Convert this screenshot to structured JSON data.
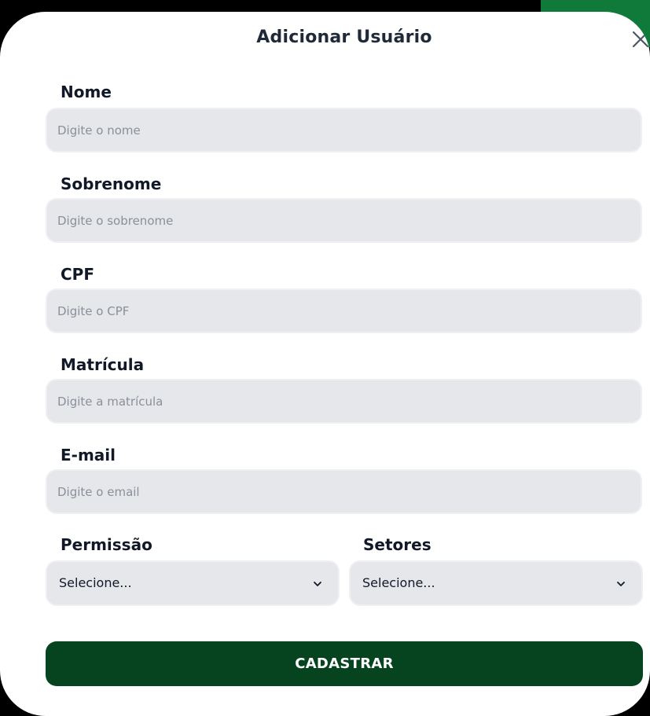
{
  "modal": {
    "title": "Adicionar Usuário",
    "close_icon": "close-icon"
  },
  "form": {
    "nome": {
      "label": "Nome",
      "placeholder": "Digite o nome",
      "value": ""
    },
    "sobrenome": {
      "label": "Sobrenome",
      "placeholder": "Digite o sobrenome",
      "value": ""
    },
    "cpf": {
      "label": "CPF",
      "placeholder": "Digite o CPF",
      "value": ""
    },
    "matricula": {
      "label": "Matrícula",
      "placeholder": "Digite a matrícula",
      "value": ""
    },
    "email": {
      "label": "E-mail",
      "placeholder": "Digite o email",
      "value": ""
    },
    "permissao": {
      "label": "Permissão",
      "selected": "Selecione...",
      "icon": "chevron-down-icon"
    },
    "setores": {
      "label": "Setores",
      "selected": "Selecione...",
      "icon": "chevron-down-icon"
    },
    "submit_label": "CADASTRAR"
  },
  "colors": {
    "backdrop": "#000000",
    "accent_green": "#0f7a3a",
    "button_green": "#064420",
    "input_bg": "#e5e7eb",
    "modal_bg": "#ffffff"
  }
}
